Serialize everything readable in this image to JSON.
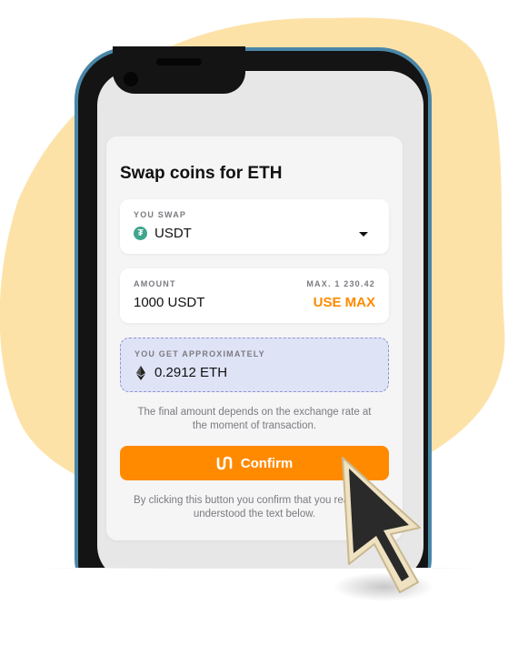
{
  "colors": {
    "accent": "#ff8a00",
    "blob": "#fde2a8",
    "phone_frame": "#4a86a7",
    "estimate_bg": "#dfe3f6",
    "tether_green": "#3fa58e"
  },
  "swap_card": {
    "title": "Swap coins for ETH",
    "you_swap": {
      "label": "YOU SWAP",
      "token_icon": "tether-icon",
      "token_symbol": "₮",
      "token": "USDT",
      "dropdown_icon": "caret-down-icon"
    },
    "amount": {
      "label": "AMOUNT",
      "max_label": "MAX. 1 230.42",
      "value": "1000 USDT",
      "use_max": "USE MAX"
    },
    "you_get": {
      "label": "YOU GET APPROXIMATELY",
      "token_icon": "ethereum-icon",
      "value": "0.2912 ETH"
    },
    "note": "The final amount depends on the exchange rate at the moment of transaction.",
    "confirm_button": {
      "icon": "brand-logo-icon",
      "label": "Confirm"
    },
    "disclaimer": "By clicking this button you confirm that you read and understood the text below."
  },
  "cursor": {
    "icon": "mouse-pointer-icon"
  }
}
